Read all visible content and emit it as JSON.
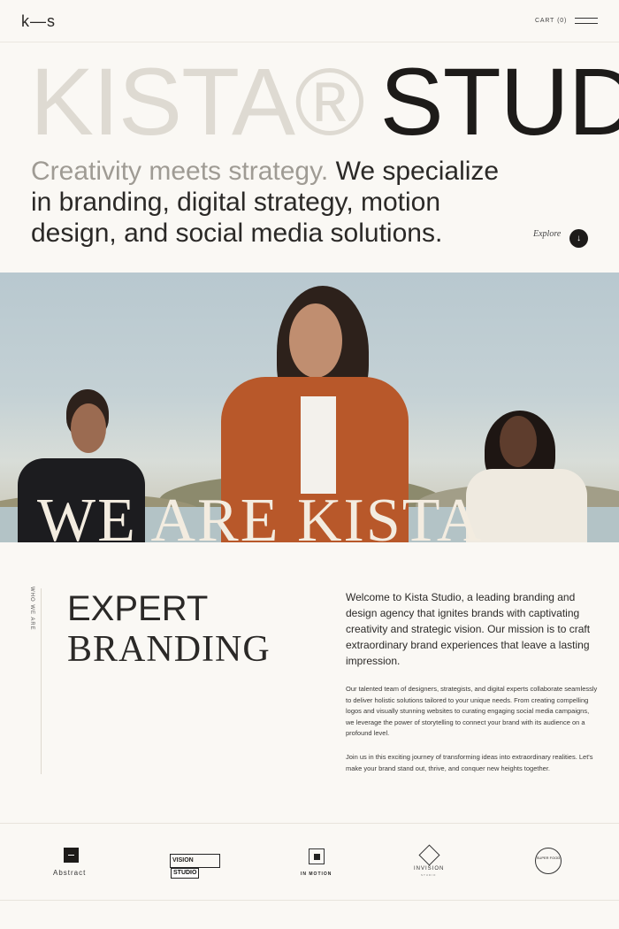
{
  "header": {
    "logo": "k—s",
    "cart_label": "CART",
    "cart_count": "(0)",
    "menu_icon": "hamburger-menu-icon"
  },
  "hero": {
    "title_part1": "KISTA®",
    "title_part2": "STUDIO",
    "tagline_lead": "Creativity meets strategy.",
    "tagline_rest": "We specialize in branding, digital strategy, motion design, and social media solutions.",
    "explore_label": "Explore",
    "explore_icon": "arrow-down-icon"
  },
  "banner": {
    "overlay_text": "WE ARE KISTA"
  },
  "about": {
    "side_label": "WHO WE ARE",
    "heading_line1": "EXPERT",
    "heading_line2": "BRANDING",
    "intro": "Welcome to Kista Studio, a leading branding and design agency that ignites brands with captivating creativity and strategic vision. Our mission is to craft extraordinary brand experiences that leave a lasting impression.",
    "paragraph1": "Our talented team of designers, strategists, and digital experts collaborate seamlessly to deliver holistic solutions tailored to your unique needs. From creating compelling logos and visually stunning websites to curating engaging social media campaigns, we leverage the power of storytelling to connect your brand with its audience on a profound level.",
    "paragraph2": "Join us in this exciting journey of transforming ideas into extraordinary realities. Let's make your brand stand out, thrive, and conquer new heights together."
  },
  "clients": {
    "abstract": "Abstract",
    "vision_part1": "VISION",
    "vision_part2": "STUDIO",
    "inmotion": "IN MOTION",
    "invision": "INVISION",
    "invision_sub": "STUDIO",
    "badge_text": "SUPER FOOD"
  },
  "colors": {
    "background": "#faf8f4",
    "text": "#1d1b19",
    "muted": "#9f9b94"
  }
}
